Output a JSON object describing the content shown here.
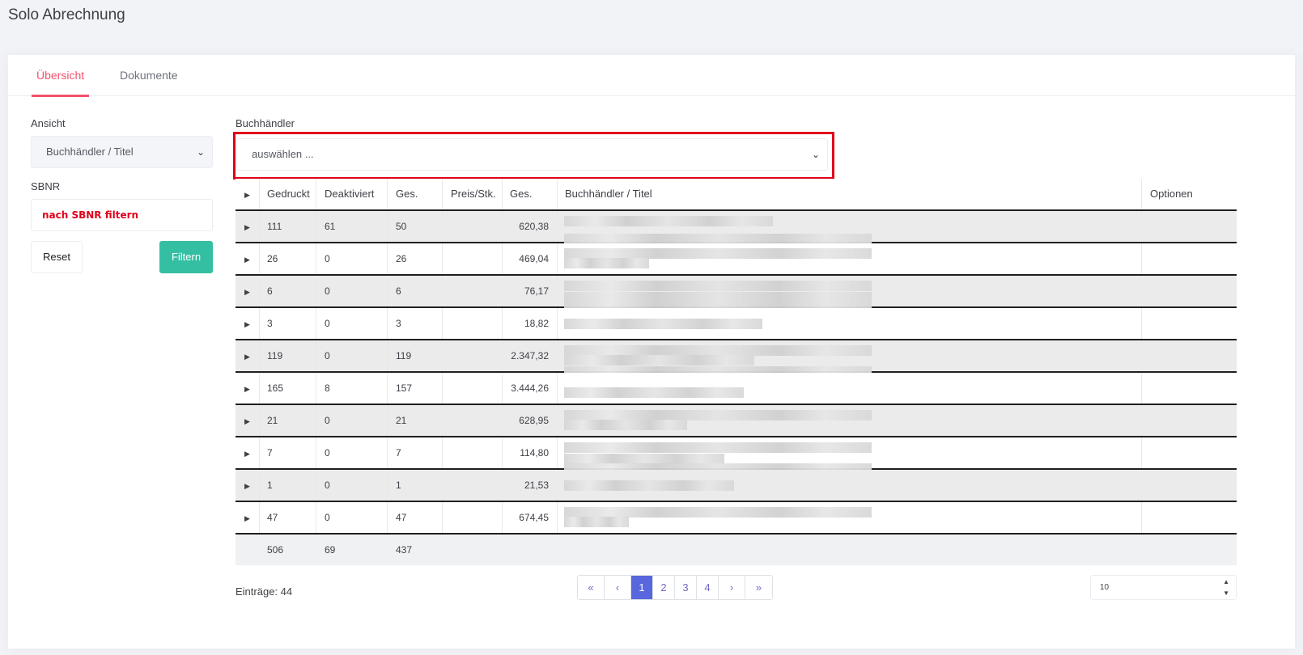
{
  "page": {
    "title": "Solo Abrechnung"
  },
  "tabs": [
    {
      "label": "Übersicht",
      "active": true
    },
    {
      "label": "Dokumente",
      "active": false
    }
  ],
  "filters": {
    "ansicht_label": "Ansicht",
    "ansicht_value": "Buchhändler / Titel",
    "sbnr_label": "SBNR",
    "sbnr_placeholder": "nach SBNR filtern",
    "reset_label": "Reset",
    "filter_label": "Filtern",
    "buchhaendler_label": "Buchhändler",
    "buchhaendler_value": "auswählen ..."
  },
  "table": {
    "headers": [
      "Gedruckt",
      "Deaktiviert",
      "Ges.",
      "Preis/Stk.",
      "Ges.",
      "Buchhändler / Titel",
      "Optionen"
    ],
    "rows": [
      {
        "gedruckt": "111",
        "deaktiviert": "61",
        "ges": "50",
        "preis": "",
        "ges_sum": "620,38"
      },
      {
        "gedruckt": "26",
        "deaktiviert": "0",
        "ges": "26",
        "preis": "",
        "ges_sum": "469,04"
      },
      {
        "gedruckt": "6",
        "deaktiviert": "0",
        "ges": "6",
        "preis": "",
        "ges_sum": "76,17"
      },
      {
        "gedruckt": "3",
        "deaktiviert": "0",
        "ges": "3",
        "preis": "",
        "ges_sum": "18,82"
      },
      {
        "gedruckt": "119",
        "deaktiviert": "0",
        "ges": "119",
        "preis": "",
        "ges_sum": "2.347,32"
      },
      {
        "gedruckt": "165",
        "deaktiviert": "8",
        "ges": "157",
        "preis": "",
        "ges_sum": "3.444,26"
      },
      {
        "gedruckt": "21",
        "deaktiviert": "0",
        "ges": "21",
        "preis": "",
        "ges_sum": "628,95"
      },
      {
        "gedruckt": "7",
        "deaktiviert": "0",
        "ges": "7",
        "preis": "",
        "ges_sum": "114,80"
      },
      {
        "gedruckt": "1",
        "deaktiviert": "0",
        "ges": "1",
        "preis": "",
        "ges_sum": "21,53"
      },
      {
        "gedruckt": "47",
        "deaktiviert": "0",
        "ges": "47",
        "preis": "",
        "ges_sum": "674,45"
      }
    ],
    "totals": {
      "gedruckt": "506",
      "deaktiviert": "69",
      "ges": "437"
    }
  },
  "footer": {
    "entries": "Einträge: 44",
    "pages": [
      "1",
      "2",
      "3",
      "4"
    ],
    "current_page": "1",
    "first_symbol": "«",
    "prev_symbol": "‹",
    "next_symbol": "›",
    "last_symbol": "»",
    "page_size": "10"
  },
  "colors": {
    "accent_tab": "#f4516c",
    "filter_button": "#34bfa3",
    "highlight_box": "#e0001a",
    "page_active": "#5867dd"
  }
}
